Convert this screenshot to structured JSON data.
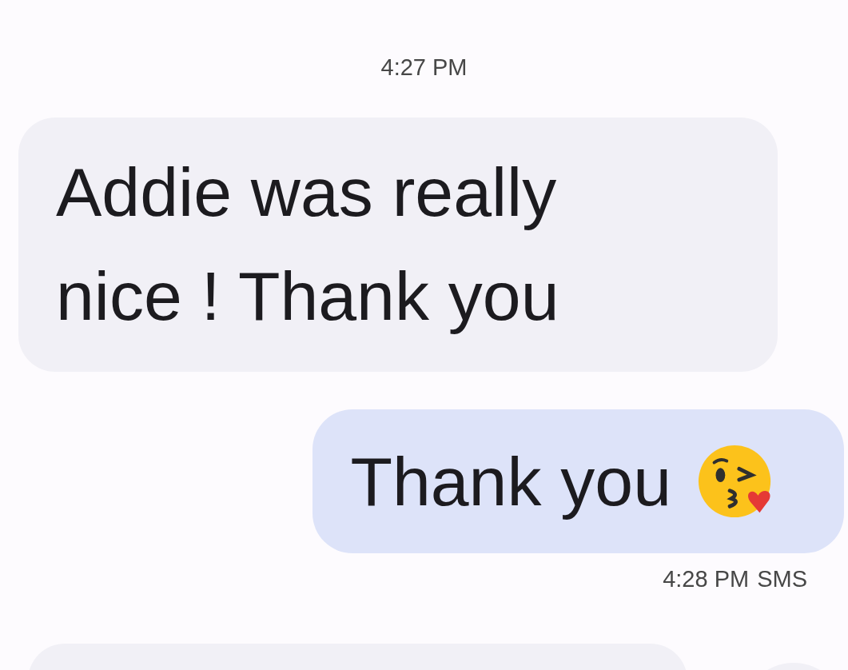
{
  "timestamp": "4:27 PM",
  "messages": [
    {
      "kind": "incoming",
      "text": "Addie was really nice ! Thank you"
    },
    {
      "kind": "outgoing",
      "text": "Thank you",
      "emoji": true,
      "time": "4:28 PM",
      "service": "SMS"
    }
  ]
}
